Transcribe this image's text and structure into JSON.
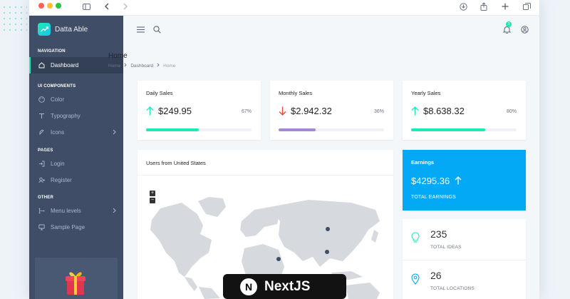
{
  "app": {
    "name": "Datta Able"
  },
  "colors": {
    "sidebar": "#3f4d67",
    "accent": "#1de9b6",
    "earnings": "#04a9f5",
    "danger": "#f44236",
    "purple": "#a389d4"
  },
  "sidebar": {
    "sections": [
      {
        "caption": "NAVIGATION",
        "items": [
          {
            "label": "Dashboard",
            "icon": "home-icon",
            "active": true
          }
        ]
      },
      {
        "caption": "UI COMPONENTS",
        "items": [
          {
            "label": "Color",
            "icon": "palette-icon"
          },
          {
            "label": "Typography",
            "icon": "type-icon"
          },
          {
            "label": "Icons",
            "icon": "feather-icon",
            "has_children": true
          }
        ]
      },
      {
        "caption": "PAGES",
        "items": [
          {
            "label": "Login",
            "icon": "login-icon"
          },
          {
            "label": "Register",
            "icon": "user-plus-icon"
          }
        ]
      },
      {
        "caption": "OTHER",
        "items": [
          {
            "label": "Menu levels",
            "icon": "menu-icon",
            "has_children": true
          },
          {
            "label": "Sample Page",
            "icon": "monitor-icon"
          }
        ]
      }
    ]
  },
  "header": {
    "notification_count": "3"
  },
  "page": {
    "title": "Home",
    "breadcrumb": [
      "Home",
      "Dashboard",
      "Home"
    ]
  },
  "stats": [
    {
      "title": "Daily Sales",
      "value": "$249.95",
      "percent": "67%",
      "trend": "up",
      "progress": 0.5,
      "bar_color": "#1de9b6"
    },
    {
      "title": "Monthly Sales",
      "value": "$2.942.32",
      "percent": "36%",
      "trend": "down",
      "progress": 0.35,
      "bar_color": "#a389d4"
    },
    {
      "title": "Yearly Sales",
      "value": "$8.638.32",
      "percent": "80%",
      "trend": "up",
      "progress": 0.7,
      "bar_color": "#1de9b6"
    }
  ],
  "map": {
    "title": "Users from United States",
    "zoom_in": "+",
    "zoom_out": "−"
  },
  "earnings": {
    "title": "Earnings",
    "value": "$4295.36",
    "label": "TOTAL EARNINGS"
  },
  "kpis": [
    {
      "value": "235",
      "label": "TOTAL IDEAS",
      "icon": "lightbulb-icon"
    },
    {
      "value": "26",
      "label": "TOTAL LOCATIONS",
      "icon": "map-pin-icon"
    }
  ],
  "overlay": {
    "text": "NextJS",
    "logo_letter": "N"
  }
}
